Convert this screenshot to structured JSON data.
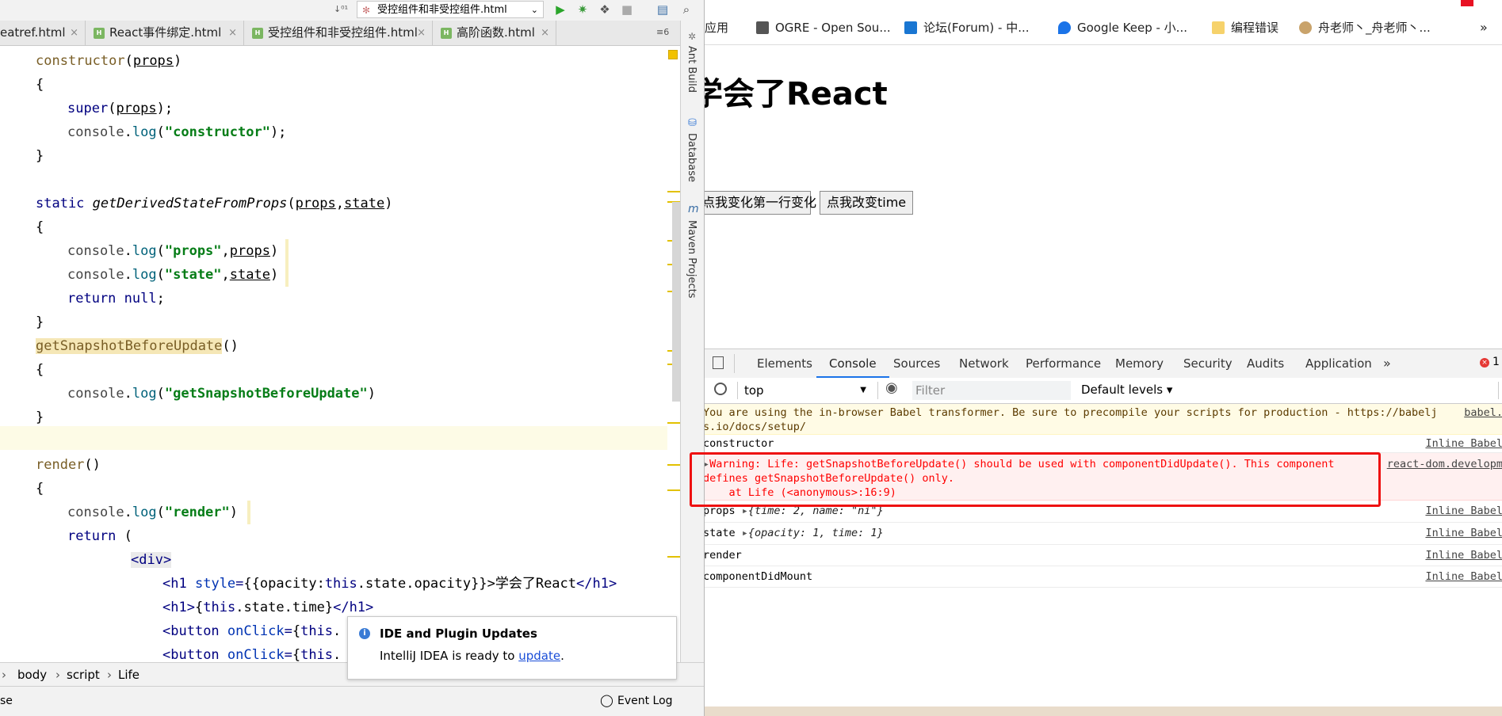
{
  "ide": {
    "run_config": "受控组件和非受控组件.html",
    "tabs": [
      {
        "label": "eatref.html"
      },
      {
        "label": "React事件绑定.html"
      },
      {
        "label": "受控组件和非受控组件.html"
      },
      {
        "label": "高阶函数.html"
      }
    ],
    "tab_overflow": "≡6",
    "side_tools": [
      "Ant Build",
      "Database",
      "Maven Projects"
    ],
    "breadcrumb": [
      "body",
      "script",
      "Life"
    ],
    "status_left": "se",
    "event_log": "Event Log",
    "popup": {
      "title": "IDE and Plugin Updates",
      "text_before": "IntelliJ IDEA is ready to ",
      "link": "update",
      "text_after": "."
    },
    "code": {
      "l1": "constructor",
      "l1b": "props",
      "l3a": "super",
      "l3b": "props",
      "l4a": "console",
      "l4b": "log",
      "l4c": "\"constructor\"",
      "l7a": "static",
      "l7b": "getDerivedStateFromProps",
      "l7c": "props",
      "l7d": "state",
      "l9c": "\"props\"",
      "l9d": "props",
      "l10c": "\"state\"",
      "l10d": "state",
      "l11a": "return",
      "l11b": "null",
      "l13": "getSnapshotBeforeUpdate",
      "l15c": "\"getSnapshotBeforeUpdate\"",
      "l18": "render",
      "l20c": "\"render\"",
      "l21a": "return",
      "l22": "div",
      "l23a": "h1",
      "l23b": "style",
      "l23c": "opacity",
      "l23d": "this",
      "l23e": "state",
      "l23f": "opacity",
      "l23g": "学会了React",
      "l24b": "this",
      "l24c": "state",
      "l24d": "time",
      "l25a": "button",
      "l25b": "onClick",
      "l25c": "this"
    }
  },
  "browser": {
    "bookmarks": [
      {
        "label": "应用",
        "color": "#4285f4"
      },
      {
        "label": "OGRE - Open Sou...",
        "color": "#555555"
      },
      {
        "label": "论坛(Forum) - 中...",
        "color": "#1976d2"
      },
      {
        "label": "Google Keep - 小...",
        "color": "#1a73e8"
      },
      {
        "label": "编程错误",
        "color": "#f6d26b"
      },
      {
        "label": "舟老师丶_舟老师丶...",
        "color": "#c9a36b"
      }
    ],
    "bookmarks_more": "»",
    "page_heading": "学会了React",
    "buttons": [
      "点我变化第一行变化",
      "点我改变time"
    ],
    "devtools": {
      "tabs": [
        "Elements",
        "Console",
        "Sources",
        "Network",
        "Performance",
        "Memory",
        "Security",
        "Audits",
        "Application"
      ],
      "active_tab": "Console",
      "overflow": "»",
      "error_count": "1",
      "context": "top",
      "filter_placeholder": "Filter",
      "levels": "Default levels ▾",
      "messages": {
        "babel_1": "You are using the in-browser Babel transformer. Be sure to precompile your scripts for production - https://babelj",
        "babel_2": "s.io/docs/setup/",
        "babel_src": "babel.",
        "constructor": "constructor",
        "warn_1": "Warning: Life: getSnapshotBeforeUpdate() should be used with componentDidUpdate(). This component",
        "warn_2": "defines getSnapshotBeforeUpdate() only.",
        "warn_3": "    at Life (<anonymous>:16:9)",
        "warn_src": "react-dom.developm",
        "props_label": "props",
        "props_obj": "{time: 2, name: \"ni\"}",
        "state_label": "state",
        "state_obj": "{opacity: 1, time: 1}",
        "render": "render",
        "did_mount": "componentDidMount",
        "inline_src": "Inline Babel"
      }
    }
  },
  "colors": {
    "warning_red": "#ff0000",
    "highlight_box": "#ee1111",
    "active_tab_blue": "#1a73e8"
  }
}
